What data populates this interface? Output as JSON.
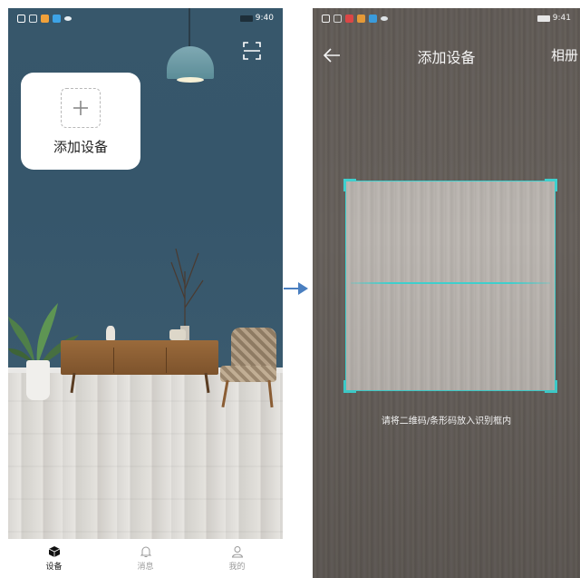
{
  "left_screen": {
    "status_time": "9:40",
    "add_device_label": "添加设备",
    "bottom_nav": [
      {
        "label": "设备",
        "icon": "device-cube-icon",
        "active": true
      },
      {
        "label": "消息",
        "icon": "bell-icon",
        "active": false
      },
      {
        "label": "我的",
        "icon": "person-icon",
        "active": false
      }
    ]
  },
  "right_screen": {
    "status_time": "9:41",
    "title": "添加设备",
    "album_label": "相册",
    "scan_hint": "请将二维码/条形码放入识别框内"
  },
  "colors": {
    "accent_scan": "#3fd2d0",
    "wall": "#36566b",
    "arrow": "#4a7fc0"
  }
}
